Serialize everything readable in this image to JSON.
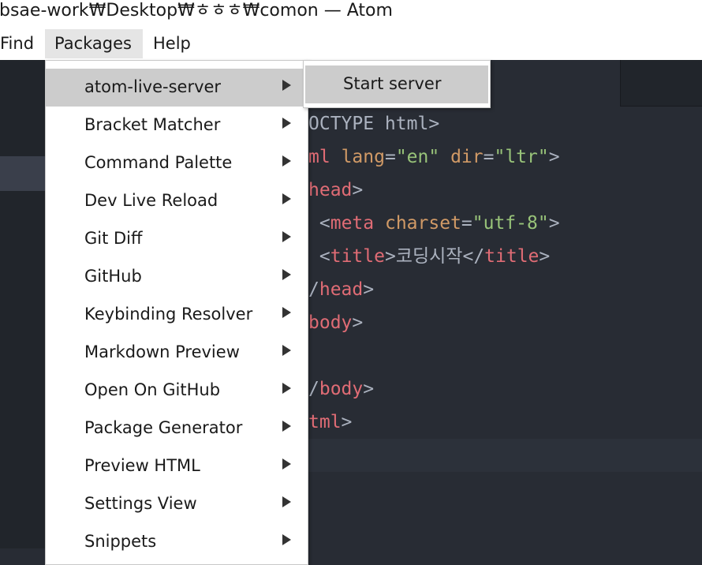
{
  "window": {
    "title": "bsae-work₩Desktop₩ㅎㅎㅎ₩comon — Atom"
  },
  "menubar": {
    "find": "Find",
    "packages": "Packages",
    "help": "Help"
  },
  "packages_menu": {
    "items": [
      {
        "label": "atom-live-server"
      },
      {
        "label": "Bracket Matcher"
      },
      {
        "label": "Command Palette"
      },
      {
        "label": "Dev Live Reload"
      },
      {
        "label": "Git Diff"
      },
      {
        "label": "GitHub"
      },
      {
        "label": "Keybinding Resolver"
      },
      {
        "label": "Markdown Preview"
      },
      {
        "label": "Open On GitHub"
      },
      {
        "label": "Package Generator"
      },
      {
        "label": "Preview HTML"
      },
      {
        "label": "Settings View"
      },
      {
        "label": "Snippets"
      }
    ],
    "highlighted": "atom-live-server"
  },
  "submenu": {
    "start_server": "Start server"
  },
  "code": {
    "l1_text": "OCTYPE html>",
    "l2_tag": "ml",
    "l2_attr1": "lang",
    "l2_eq1": "=",
    "l2_val1": "\"en\"",
    "l2_attr2": "dir",
    "l2_eq2": "=",
    "l2_val2": "\"ltr\"",
    "l2_close": ">",
    "l3_tag": "head",
    "l3_close": ">",
    "l4_open": "<",
    "l4_tag": "meta",
    "l4_attr": "charset",
    "l4_eq": "=",
    "l4_val": "\"utf-8\"",
    "l4_close": ">",
    "l5_open": "<",
    "l5_tag": "title",
    "l5_mid": ">",
    "l5_text": "코딩시작",
    "l5_open2": "</",
    "l5_tag2": "title",
    "l5_close": ">",
    "l6_slash": "/",
    "l6_tag": "head",
    "l6_close": ">",
    "l7_tag": "body",
    "l7_close": ">",
    "l9_slash": "/",
    "l9_tag": "body",
    "l9_close": ">",
    "l10_tag": "tml",
    "l10_close": ">"
  },
  "colors": {
    "tag": "#e06c75",
    "attr": "#d19a66",
    "string": "#98c379",
    "punct": "#abb2bf",
    "editor_bg": "#282c34"
  }
}
